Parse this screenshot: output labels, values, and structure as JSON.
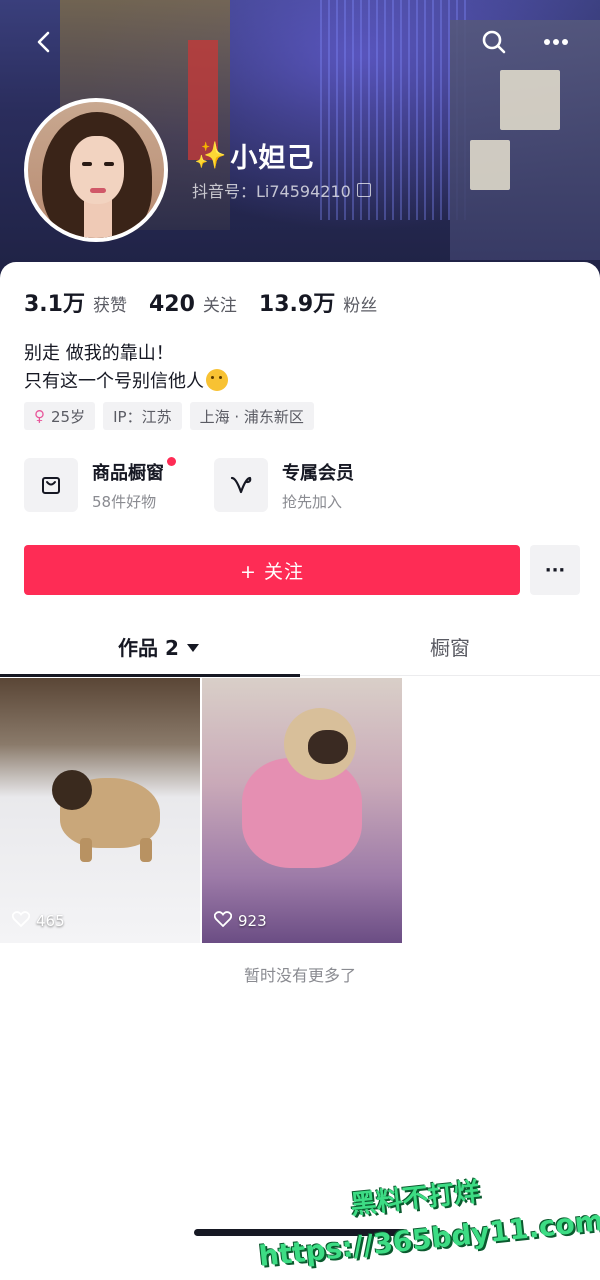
{
  "header": {
    "username": "小妲己",
    "sparkle": "✨",
    "douyin_id": "抖音号：Li74594210"
  },
  "stats": [
    {
      "value": "3.1万",
      "label": "获赞"
    },
    {
      "value": "420",
      "label": "关注"
    },
    {
      "value": "13.9万",
      "label": "粉丝"
    }
  ],
  "bio": {
    "line1": "别走 做我的靠山！",
    "line2": "只有这一个号别信他人"
  },
  "tags": {
    "age": "25岁",
    "ip": "IP：江苏",
    "location": "上海 · 浦东新区"
  },
  "features": {
    "shop": {
      "title": "商品橱窗",
      "subtitle": "58件好物"
    },
    "member": {
      "title": "专属会员",
      "subtitle": "抢先加入"
    }
  },
  "actions": {
    "follow": "+ 关注",
    "more": "···"
  },
  "tabs": {
    "works": "作品 2",
    "window": "橱窗"
  },
  "videos": [
    {
      "likes": "465"
    },
    {
      "likes": "923"
    }
  ],
  "footer": {
    "no_more": "暂时没有更多了"
  },
  "watermark": {
    "line1": "黑料不打烊",
    "line2": "https://365bdy11.com"
  },
  "colors": {
    "accent": "#fe2c55"
  }
}
